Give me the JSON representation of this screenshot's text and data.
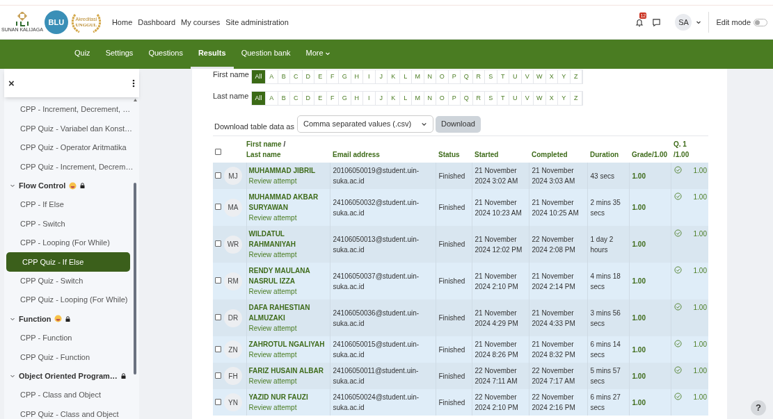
{
  "logos": [
    {
      "kind": "emblem",
      "text": "SUNAN KALIJAGA"
    },
    {
      "kind": "circle",
      "text": "BLU"
    },
    {
      "kind": "wreath",
      "text": "UNGGUL",
      "subtext": "Akreditasi"
    }
  ],
  "top_nav": [
    "Home",
    "Dashboard",
    "My courses",
    "Site administration"
  ],
  "notifications": {
    "count": "12"
  },
  "user": {
    "initials": "SA"
  },
  "edit_mode": {
    "label": "Edit mode",
    "on": false
  },
  "secondary_nav": [
    {
      "label": "Quiz",
      "selected": false
    },
    {
      "label": "Settings",
      "selected": false
    },
    {
      "label": "Questions",
      "selected": false
    },
    {
      "label": "Results",
      "selected": true
    },
    {
      "label": "Question bank",
      "selected": false
    },
    {
      "label": "More",
      "selected": false,
      "dropdown": true
    }
  ],
  "drawer": {
    "close": "×",
    "items": [
      {
        "kind": "item",
        "label": "CPP - Increment, Decrement, …",
        "selected": false
      },
      {
        "kind": "item",
        "label": "CPP Quiz - Variabel dan Konst…",
        "selected": false
      },
      {
        "kind": "item",
        "label": "CPP Quiz - Operator Aritmatika",
        "selected": false
      },
      {
        "kind": "item",
        "label": "CPP Quiz - Increment, Decrem…",
        "selected": false
      },
      {
        "kind": "section",
        "label": "Flow Control",
        "expanded": true,
        "locked": true,
        "emoji": true,
        "selected": false
      },
      {
        "kind": "item",
        "label": "CPP - If Else",
        "selected": false
      },
      {
        "kind": "item",
        "label": "CPP - Switch",
        "selected": false
      },
      {
        "kind": "item",
        "label": "CPP - Looping (For While)",
        "selected": false
      },
      {
        "kind": "item",
        "label": "CPP Quiz - If Else",
        "selected": true
      },
      {
        "kind": "item",
        "label": "CPP Quiz - Switch",
        "selected": false
      },
      {
        "kind": "item",
        "label": "CPP Quiz - Looping (For While)",
        "selected": false
      },
      {
        "kind": "section",
        "label": "Function",
        "expanded": true,
        "locked": true,
        "emoji": true,
        "selected": false
      },
      {
        "kind": "item",
        "label": "CPP - Function",
        "selected": false
      },
      {
        "kind": "item",
        "label": "CPP Quiz - Function",
        "selected": false
      },
      {
        "kind": "section",
        "label": "Object Oriented Program…",
        "expanded": true,
        "locked": true,
        "selected": false
      },
      {
        "kind": "item",
        "label": "CPP - Class and Object",
        "selected": false
      },
      {
        "kind": "item",
        "label": "CPP Quiz - Class and Object",
        "selected": false
      }
    ]
  },
  "initial_filters": [
    {
      "label": "First name",
      "letters": [
        {
          "label": "All",
          "selected": true
        },
        {
          "label": "A",
          "selected": false
        },
        {
          "label": "B",
          "selected": false
        },
        {
          "label": "C",
          "selected": false
        },
        {
          "label": "D",
          "selected": false
        },
        {
          "label": "E",
          "selected": false
        },
        {
          "label": "F",
          "selected": false
        },
        {
          "label": "G",
          "selected": false
        },
        {
          "label": "H",
          "selected": false
        },
        {
          "label": "I",
          "selected": false
        },
        {
          "label": "J",
          "selected": false
        },
        {
          "label": "K",
          "selected": false
        },
        {
          "label": "L",
          "selected": false
        },
        {
          "label": "M",
          "selected": false
        },
        {
          "label": "N",
          "selected": false
        },
        {
          "label": "O",
          "selected": false
        },
        {
          "label": "P",
          "selected": false
        },
        {
          "label": "Q",
          "selected": false
        },
        {
          "label": "R",
          "selected": false
        },
        {
          "label": "S",
          "selected": false
        },
        {
          "label": "T",
          "selected": false
        },
        {
          "label": "U",
          "selected": false
        },
        {
          "label": "V",
          "selected": false
        },
        {
          "label": "W",
          "selected": false
        },
        {
          "label": "X",
          "selected": false
        },
        {
          "label": "Y",
          "selected": false
        },
        {
          "label": "Z",
          "selected": false
        }
      ]
    },
    {
      "label": "Last name",
      "letters": [
        {
          "label": "All",
          "selected": true
        },
        {
          "label": "A",
          "selected": false
        },
        {
          "label": "B",
          "selected": false
        },
        {
          "label": "C",
          "selected": false
        },
        {
          "label": "D",
          "selected": false
        },
        {
          "label": "E",
          "selected": false
        },
        {
          "label": "F",
          "selected": false
        },
        {
          "label": "G",
          "selected": false
        },
        {
          "label": "H",
          "selected": false
        },
        {
          "label": "I",
          "selected": false
        },
        {
          "label": "J",
          "selected": false
        },
        {
          "label": "K",
          "selected": false
        },
        {
          "label": "L",
          "selected": false
        },
        {
          "label": "M",
          "selected": false
        },
        {
          "label": "N",
          "selected": false
        },
        {
          "label": "O",
          "selected": false
        },
        {
          "label": "P",
          "selected": false
        },
        {
          "label": "Q",
          "selected": false
        },
        {
          "label": "R",
          "selected": false
        },
        {
          "label": "S",
          "selected": false
        },
        {
          "label": "T",
          "selected": false
        },
        {
          "label": "U",
          "selected": false
        },
        {
          "label": "V",
          "selected": false
        },
        {
          "label": "W",
          "selected": false
        },
        {
          "label": "X",
          "selected": false
        },
        {
          "label": "Y",
          "selected": false
        },
        {
          "label": "Z",
          "selected": false
        }
      ]
    }
  ],
  "download": {
    "label": "Download table data as",
    "format": "Comma separated values (.csv)",
    "button": "Download"
  },
  "table": {
    "select_all": {
      "checked": false
    },
    "columns": {
      "first_name": "First name",
      "separator": "/",
      "last_name": "Last name",
      "email": "Email address",
      "status": "Status",
      "started": "Started",
      "completed": "Completed",
      "duration": "Duration",
      "grade": "Grade/1.00",
      "q1": "Q. 1",
      "q1_max": "/1.00"
    },
    "rows": [
      {
        "checked": false,
        "initials": "MJ",
        "name": "MUHAMMAD JIBRIL",
        "link": "Review attempt",
        "email": "20106050019@student.uin-suka.ac.id",
        "status": "Finished",
        "started": "21 November 2024 3:02 AM",
        "completed": "21 November 2024 3:03 AM",
        "duration": "43 secs",
        "grade": "1.00",
        "correct": true,
        "q1": "1.00"
      },
      {
        "checked": false,
        "initials": "MA",
        "name": "MUHAMMAD AKBAR SURYAWAN",
        "link": "Review attempt",
        "email": "24106050032@student.uin-suka.ac.id",
        "status": "Finished",
        "started": "21 November 2024 10:23 AM",
        "completed": "21 November 2024 10:25 AM",
        "duration": "2 mins 35 secs",
        "grade": "1.00",
        "correct": true,
        "q1": "1.00"
      },
      {
        "checked": false,
        "initials": "WR",
        "name": "WILDATUL RAHMANIYAH",
        "link": "Review attempt",
        "email": "24106050013@student.uin-suka.ac.id",
        "status": "Finished",
        "started": "21 November 2024 12:02 PM",
        "completed": "22 November 2024 2:08 PM",
        "duration": "1 day 2 hours",
        "grade": "1.00",
        "correct": true,
        "q1": "1.00"
      },
      {
        "checked": false,
        "initials": "RM",
        "name": "RENDY MAULANA NASRUL IZZA",
        "link": "Review attempt",
        "email": "24106050037@student.uin-suka.ac.id",
        "status": "Finished",
        "started": "21 November 2024 2:10 PM",
        "completed": "21 November 2024 2:14 PM",
        "duration": "4 mins 18 secs",
        "grade": "1.00",
        "correct": true,
        "q1": "1.00"
      },
      {
        "checked": false,
        "initials": "DR",
        "name": "DAFA RAHESTIAN ALMUZAKI",
        "link": "Review attempt",
        "email": "24106050036@student.uin-suka.ac.id",
        "status": "Finished",
        "started": "21 November 2024 4:29 PM",
        "completed": "21 November 2024 4:33 PM",
        "duration": "3 mins 56 secs",
        "grade": "1.00",
        "correct": true,
        "q1": "1.00"
      },
      {
        "checked": false,
        "initials": "ZN",
        "name": "ZAHROTUL NGALIYAH",
        "link": "Review attempt",
        "email": "24106050015@student.uin-suka.ac.id",
        "status": "Finished",
        "started": "21 November 2024 8:26 PM",
        "completed": "21 November 2024 8:32 PM",
        "duration": "6 mins 14 secs",
        "grade": "1.00",
        "correct": true,
        "q1": "1.00"
      },
      {
        "checked": false,
        "initials": "FH",
        "name": "FARIZ HUSAIN ALBAR",
        "link": "Review attempt",
        "email": "24106050011@student.uin-suka.ac.id",
        "status": "Finished",
        "started": "22 November 2024 7:11 AM",
        "completed": "22 November 2024 7:17 AM",
        "duration": "5 mins 57 secs",
        "grade": "1.00",
        "correct": true,
        "q1": "1.00"
      },
      {
        "checked": false,
        "initials": "YN",
        "name": "YAZID NUR FAUZI",
        "link": "Review attempt",
        "email": "24106050024@student.uin-suka.ac.id",
        "status": "Finished",
        "started": "22 November 2024 2:10 PM",
        "completed": "22 November 2024 2:16 PM",
        "duration": "6 mins 27 secs",
        "grade": "1.00",
        "correct": true,
        "q1": "1.00"
      }
    ]
  },
  "help": "?"
}
